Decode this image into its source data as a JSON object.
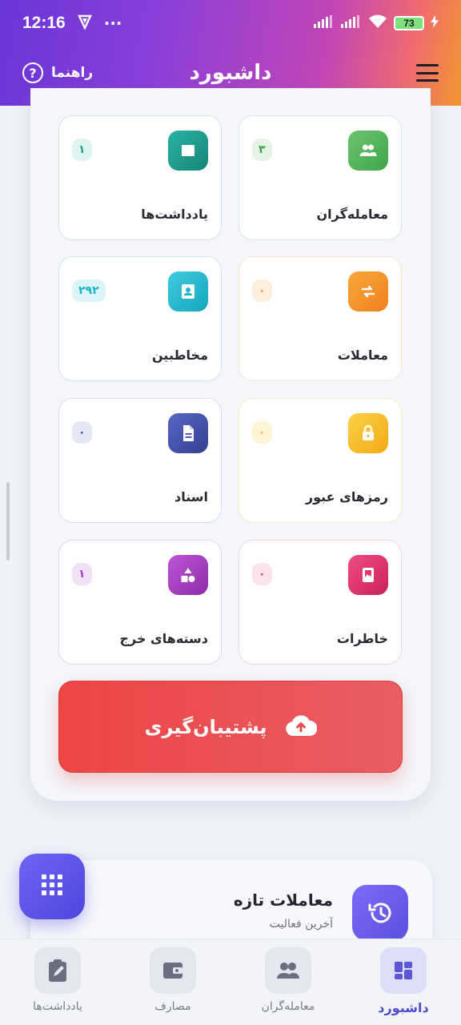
{
  "status_bar": {
    "time": "12:16",
    "dots": "···",
    "battery": "73"
  },
  "header": {
    "title": "داشبورد",
    "help_label": "راهنما",
    "help_icon_char": "?"
  },
  "tiles": [
    {
      "label": "معامله‌گران",
      "count": "۳",
      "icon": "people-icon",
      "accent": "#3fa64a",
      "badge_bg": "#e6f4e7",
      "border": "#d7ecd9"
    },
    {
      "label": "یادداشت‌ها",
      "count": "۱",
      "icon": "note-icon",
      "accent": "#1f9e8f",
      "badge_bg": "#dff4f1",
      "border": "#cfe8e4"
    },
    {
      "label": "معاملات",
      "count": "۰",
      "icon": "swap-icon",
      "accent": "#f2902b",
      "badge_bg": "#fdeedd",
      "border": "#f6e4c8"
    },
    {
      "label": "مخاطبین",
      "count": "۲۹۲",
      "icon": "contacts-icon",
      "accent": "#1fb3c9",
      "badge_bg": "#dcf4f8",
      "border": "#cde9ee"
    },
    {
      "label": "رمزهای عبور",
      "count": "۰",
      "icon": "lock-icon",
      "accent": "#f5b720",
      "badge_bg": "#fdf3d7",
      "border": "#f7ebc6"
    },
    {
      "label": "اسناد",
      "count": "۰",
      "icon": "document-icon",
      "accent": "#3f4ba8",
      "badge_bg": "#e5e7f5",
      "border": "#d8dcef"
    },
    {
      "label": "خاطرات",
      "count": "۰",
      "icon": "diary-icon",
      "accent": "#e0336b",
      "badge_bg": "#fbe3ec",
      "border": "#f1d4df"
    },
    {
      "label": "دسته‌های خرج",
      "count": "۱",
      "icon": "category-icon",
      "accent": "#a63fbf",
      "badge_bg": "#f1e1f6",
      "border": "#e8d6ee"
    }
  ],
  "backup": {
    "label": "پشتیبان‌گیری",
    "icon": "cloud-upload-icon"
  },
  "recent": {
    "title": "معاملات تازه",
    "subtitle": "آخرین فعالیت",
    "icon": "history-icon"
  },
  "fab": {
    "icon": "grid-icon"
  },
  "bottom_nav": [
    {
      "label": "داشبورد",
      "icon": "dashboard-icon",
      "active": true
    },
    {
      "label": "معامله‌گران",
      "icon": "people-icon",
      "active": false
    },
    {
      "label": "مصارف",
      "icon": "wallet-icon",
      "active": false
    },
    {
      "label": "یادداشت‌ها",
      "icon": "clipboard-icon",
      "active": false
    }
  ]
}
